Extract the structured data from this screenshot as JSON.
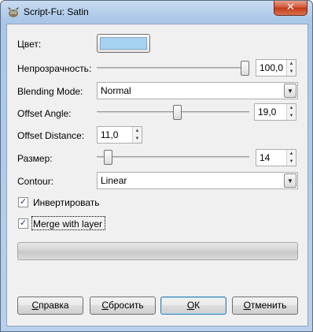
{
  "window": {
    "title": "Script-Fu: Satin",
    "close_glyph": "✕",
    "app_icon": "gimp-wilber-icon"
  },
  "fields": {
    "color": {
      "label": "Цвет:",
      "value_hex": "#a6d2f2"
    },
    "opacity": {
      "label": "Непрозрачность:",
      "value": "100,0",
      "slider_fraction": 1.0
    },
    "blending_mode": {
      "label": "Blending Mode:",
      "value": "Normal"
    },
    "offset_angle": {
      "label": "Offset Angle:",
      "value": "19,0",
      "slider_fraction": 0.53
    },
    "offset_distance": {
      "label": "Offset Distance:",
      "value": "11,0"
    },
    "size": {
      "label": "Размер:",
      "value": "14",
      "slider_fraction": 0.05
    },
    "contour": {
      "label": "Contour:",
      "value": "Linear"
    },
    "invert": {
      "label": "Инвертировать",
      "checked": true
    },
    "merge": {
      "label": "Merge with layer",
      "checked": true
    }
  },
  "buttons": {
    "help": {
      "mnemonic": "С",
      "rest": "правка"
    },
    "reset": {
      "mnemonic": "С",
      "rest": "бросить"
    },
    "ok": {
      "mnemonic": "О",
      "rest": "К"
    },
    "cancel": {
      "mnemonic": "О",
      "rest": "тменить"
    }
  },
  "icons": {
    "spin_up": "▲",
    "spin_down": "▼",
    "dropdown": "▼",
    "checkmark": "✓"
  },
  "progress": {
    "fraction": 0
  }
}
